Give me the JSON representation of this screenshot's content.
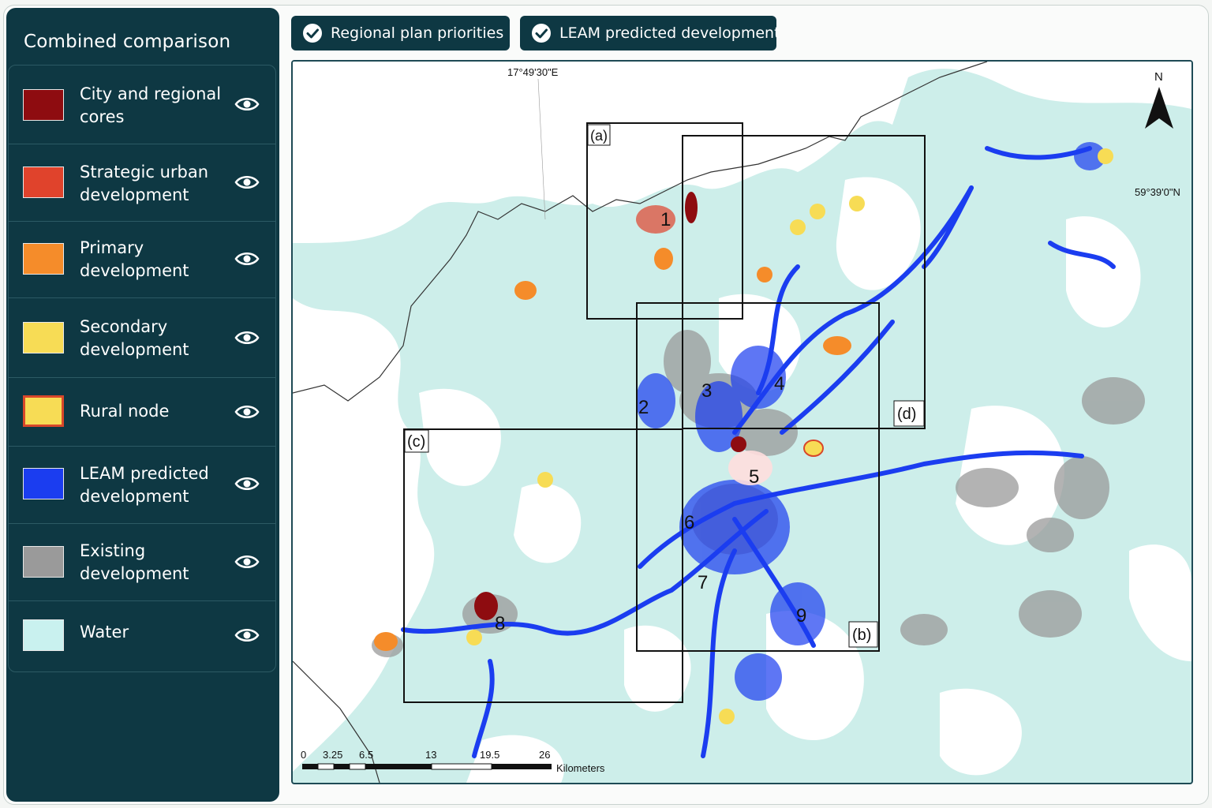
{
  "sidebar": {
    "title": "Combined comparison",
    "items": [
      {
        "label": "City and regional cores",
        "color": "#8e0c10",
        "icon": "eye-icon"
      },
      {
        "label": "Strategic urban development",
        "color": "#e0432c",
        "icon": "eye-icon"
      },
      {
        "label": "Primary development",
        "color": "#f58c2a",
        "icon": "eye-icon"
      },
      {
        "label": "Secondary development",
        "color": "#f7dc55",
        "icon": "eye-icon"
      },
      {
        "label": "Rural node",
        "color": "#f7dc55",
        "border": "#d8472a",
        "icon": "eye-icon"
      },
      {
        "label": "LEAM predicted development",
        "color": "#1b3df0",
        "icon": "eye-icon"
      },
      {
        "label": "Existing development",
        "color": "#9a9a9a",
        "icon": "eye-icon"
      },
      {
        "label": "Water",
        "color": "#c9f1ef",
        "icon": "eye-icon"
      }
    ]
  },
  "toolbar": {
    "btn1": "Regional plan priorities",
    "btn2": "LEAM predicted development",
    "btn_icon": "check-circle-icon"
  },
  "map": {
    "longitude_label": "17°49'30\"E",
    "latitude_label": "59°39'0\"N",
    "north_label": "N",
    "inset_labels": [
      "(a)",
      "(b)",
      "(c)",
      "(d)"
    ],
    "area_numbers": [
      "1",
      "2",
      "3",
      "4",
      "5",
      "6",
      "7",
      "8",
      "9"
    ],
    "scale_ticks": [
      "0",
      "3.25",
      "6.5",
      "13",
      "19.5",
      "26"
    ],
    "scale_unit": "Kilometers"
  }
}
